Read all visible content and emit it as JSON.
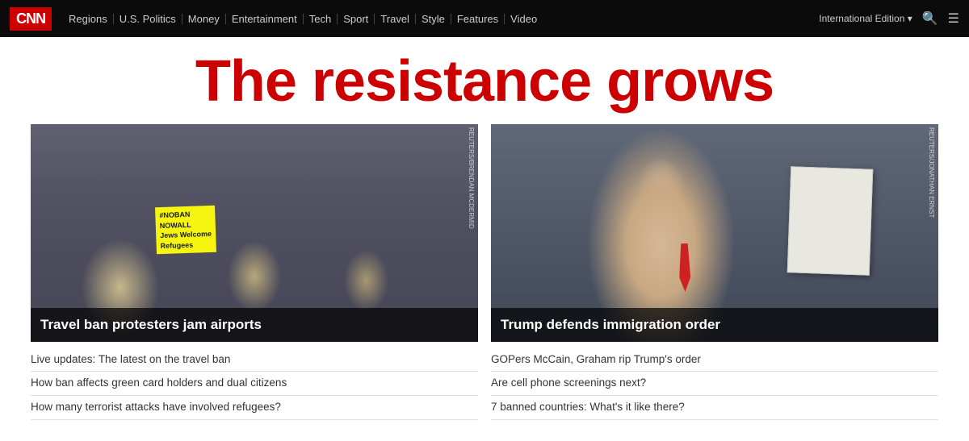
{
  "nav": {
    "logo": "CNN",
    "links": [
      "Regions",
      "U.S. Politics",
      "Money",
      "Entertainment",
      "Tech",
      "Sport",
      "Travel",
      "Style",
      "Features",
      "Video"
    ],
    "intl_edition": "International Edition ▾",
    "search_icon": "🔍",
    "menu_icon": "☰"
  },
  "headline": {
    "main": "The resistance grows"
  },
  "stories": [
    {
      "id": "story-left",
      "image_alt": "Travel ban protesters at airport",
      "caption": "Travel ban protesters jam airports",
      "links": [
        "Live updates: The latest on the travel ban",
        "How ban affects green card holders and dual citizens",
        "How many terrorist attacks have involved refugees?"
      ]
    },
    {
      "id": "story-right",
      "image_alt": "Trump defends immigration order",
      "caption": "Trump defends immigration order",
      "links": [
        "GOPers McCain, Graham rip Trump's order",
        "Are cell phone screenings next?",
        "7 banned countries: What's it like there?"
      ]
    }
  ]
}
